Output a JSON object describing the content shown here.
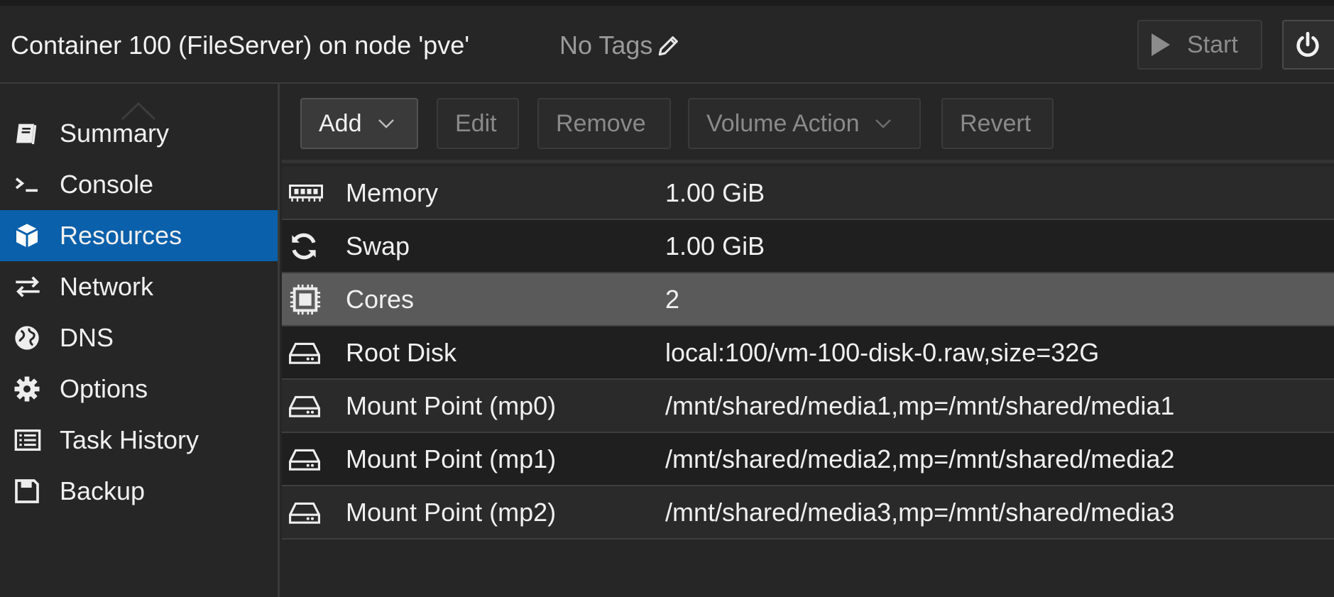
{
  "header": {
    "title": "Container 100 (FileServer) on node 'pve'",
    "tags_label": "No Tags",
    "start_label": "Start"
  },
  "sidebar": {
    "items": [
      {
        "label": "Summary",
        "icon": "book-icon"
      },
      {
        "label": "Console",
        "icon": "terminal-icon"
      },
      {
        "label": "Resources",
        "icon": "cube-icon",
        "active": true
      },
      {
        "label": "Network",
        "icon": "exchange-icon"
      },
      {
        "label": "DNS",
        "icon": "globe-icon"
      },
      {
        "label": "Options",
        "icon": "gear-icon"
      },
      {
        "label": "Task History",
        "icon": "list-icon"
      },
      {
        "label": "Backup",
        "icon": "save-icon"
      }
    ]
  },
  "toolbar": {
    "add_label": "Add",
    "edit_label": "Edit",
    "remove_label": "Remove",
    "volume_action_label": "Volume Action",
    "revert_label": "Revert"
  },
  "resources": [
    {
      "name": "Memory",
      "value": "1.00 GiB",
      "icon": "memory-icon"
    },
    {
      "name": "Swap",
      "value": "1.00 GiB",
      "icon": "refresh-icon"
    },
    {
      "name": "Cores",
      "value": "2",
      "icon": "cpu-icon",
      "selected": true
    },
    {
      "name": "Root Disk",
      "value": "local:100/vm-100-disk-0.raw,size=32G",
      "icon": "hdd-icon"
    },
    {
      "name": "Mount Point (mp0)",
      "value": "/mnt/shared/media1,mp=/mnt/shared/media1",
      "icon": "hdd-icon"
    },
    {
      "name": "Mount Point (mp1)",
      "value": "/mnt/shared/media2,mp=/mnt/shared/media2",
      "icon": "hdd-icon"
    },
    {
      "name": "Mount Point (mp2)",
      "value": "/mnt/shared/media3,mp=/mnt/shared/media3",
      "icon": "hdd-icon"
    }
  ],
  "colors": {
    "accent": "#0a60aa",
    "background": "#262626",
    "selected_row": "#5a5a5a"
  }
}
